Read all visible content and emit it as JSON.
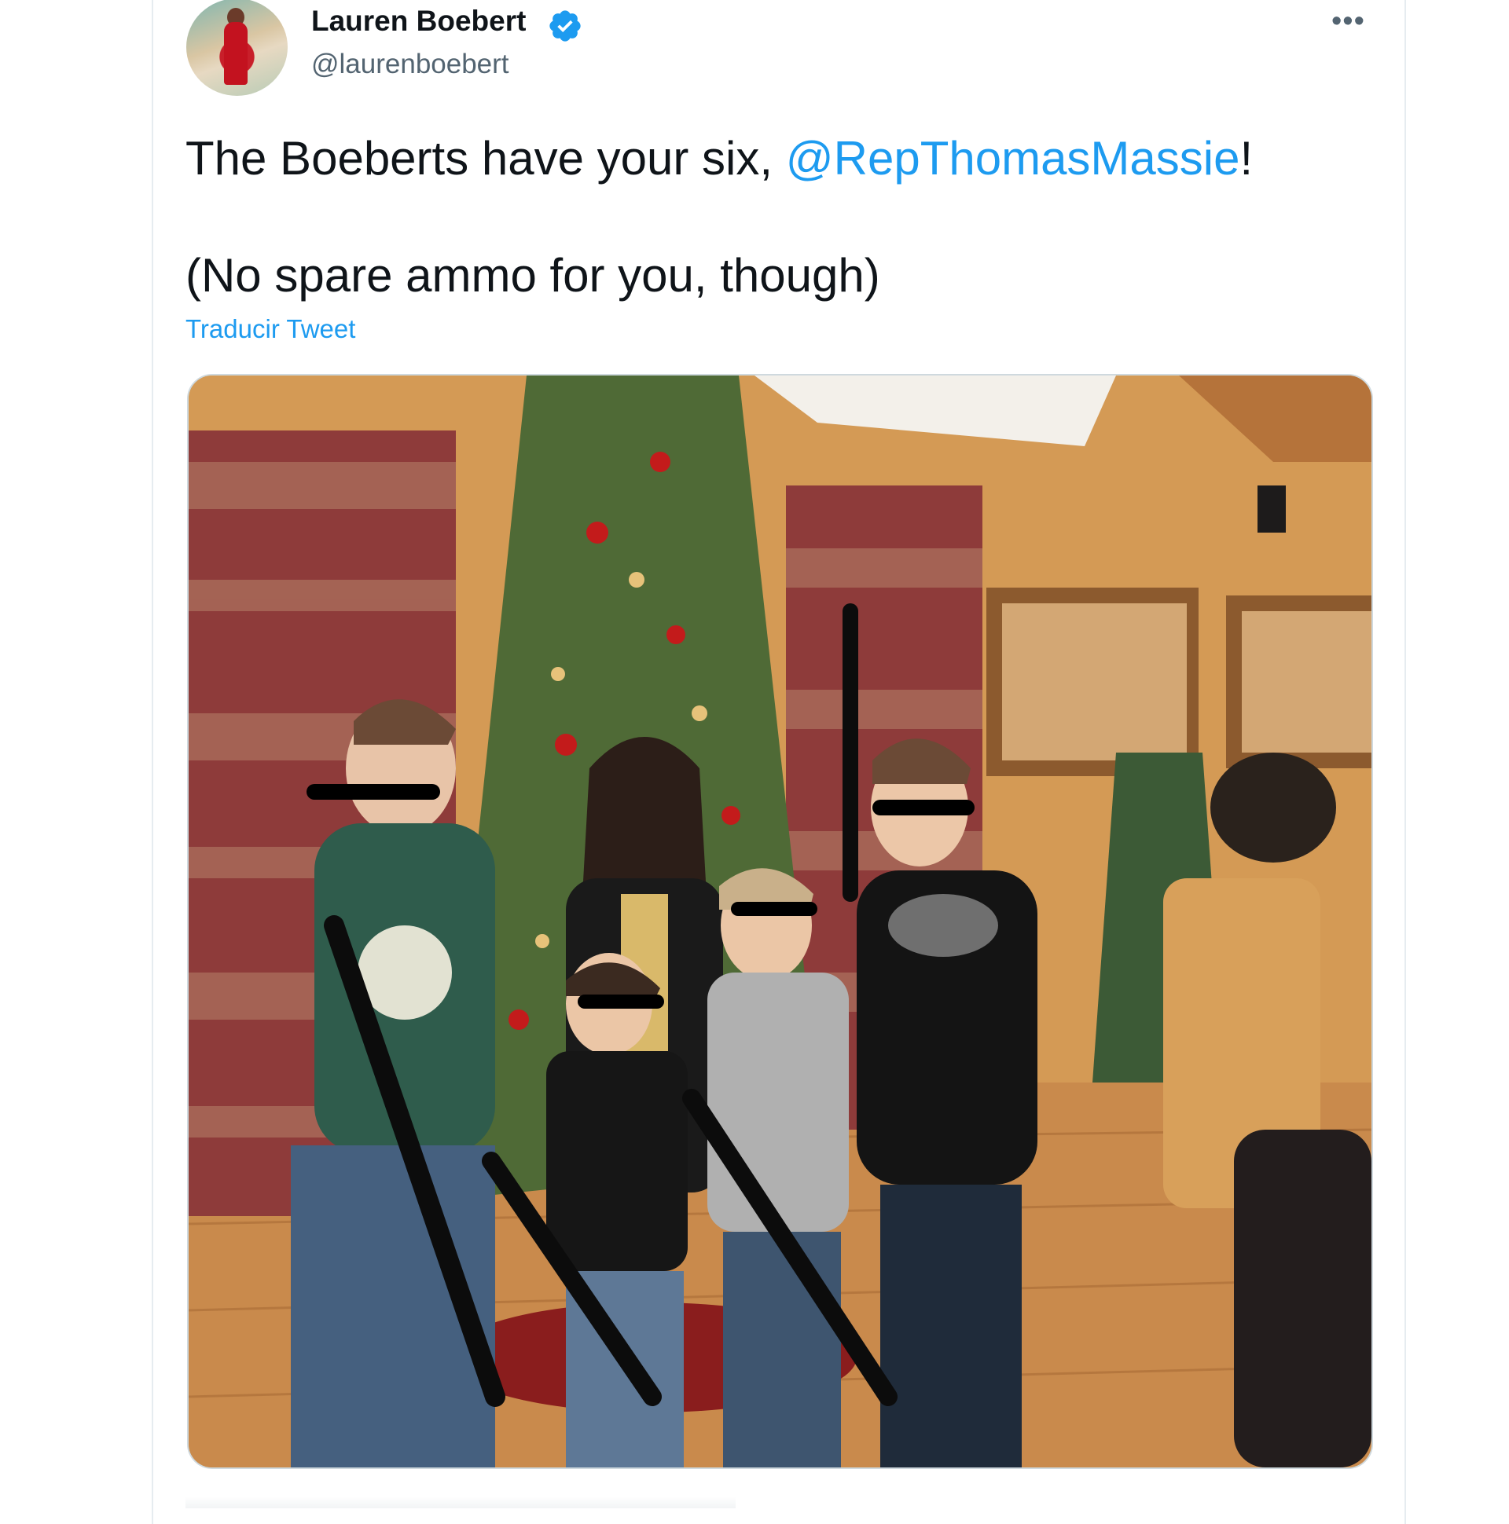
{
  "tweet": {
    "author_name": "Lauren Boebert",
    "author_handle": "@laurenboebert",
    "verified_icon": "verified-badge-icon",
    "more_icon": "more-options-icon",
    "more_symbol": "•••",
    "text_line1_prefix": "The Boeberts have your six, ",
    "text_line1_mention": "@RepThomasMassie",
    "text_line1_suffix": "!",
    "text_line2": "(No spare ammo for you, though)",
    "translate_label": "Traducir Tweet"
  },
  "colors": {
    "accent": "#1d9bf0",
    "text": "#0f1419",
    "secondary": "#536471"
  }
}
